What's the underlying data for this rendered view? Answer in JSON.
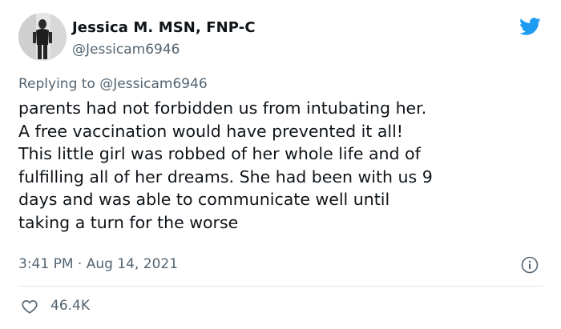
{
  "author": {
    "display_name": "Jessica M. MSN, FNP-C",
    "handle": "@Jessicam6946",
    "avatar_icon": "avatar-photo"
  },
  "brand": {
    "icon": "twitter-bird-icon",
    "color": "#1d9bf0"
  },
  "reply": {
    "prefix": "Replying to",
    "mention": "@Jessicam6946"
  },
  "tweet": {
    "lines": [
      "parents had not forbidden us from intubating her.",
      "A free vaccination would have prevented it all!",
      "This little girl was robbed of her whole life and of",
      "fulfilling all of her dreams. She had been with us 9",
      "days and was able to communicate well until",
      "taking a turn for the worse"
    ]
  },
  "meta": {
    "timestamp": "3:41 PM · Aug 14, 2021",
    "info_icon": "info-icon"
  },
  "engagement": {
    "like_icon": "heart-icon",
    "likes": "46.4K"
  },
  "colors": {
    "text": "#0f1419",
    "secondary": "#536471",
    "divider": "#e1e8ed"
  }
}
